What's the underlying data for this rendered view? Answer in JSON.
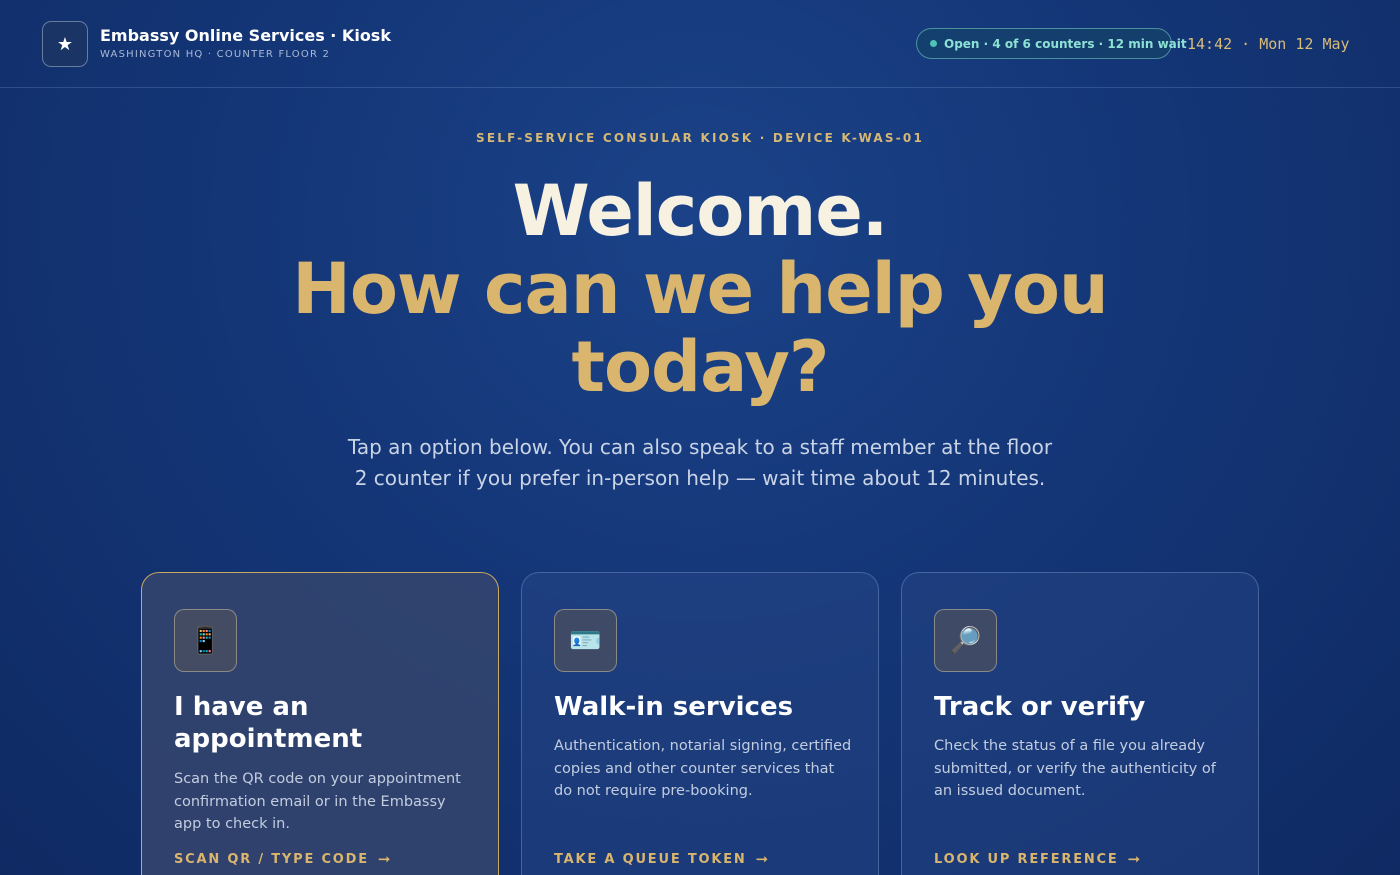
{
  "header": {
    "logo_icon": "star-icon",
    "logo_glyph": "★",
    "title": "Embassy Online Services · Kiosk",
    "subtitle": "WASHINGTON HQ · COUNTER FLOOR 2",
    "status": "Open · 4 of 6 counters · 12 min wait",
    "clock": "14:42 · Mon 12 May"
  },
  "hero": {
    "eyebrow": "SELF-SERVICE CONSULAR KIOSK · DEVICE K-WAS-01",
    "title_line1": "Welcome.",
    "title_line2": "How can we help you today?",
    "description": "Tap an option below. You can also speak to a staff member at the floor 2 counter if you prefer in-person help — wait time about 12 minutes."
  },
  "cards": [
    {
      "icon": "mobile-phone-icon",
      "glyph": "📱",
      "title": "I have an appointment",
      "description": "Scan the QR code on your appointment confirmation email or in the Embassy app to check in.",
      "action": "SCAN QR / TYPE CODE"
    },
    {
      "icon": "id-card-icon",
      "glyph": "🪪",
      "title": "Walk-in services",
      "description": "Authentication, notarial signing, certified copies and other counter services that do not require pre-booking.",
      "action": "TAKE A QUEUE TOKEN"
    },
    {
      "icon": "magnifier-icon",
      "glyph": "🔎",
      "title": "Track or verify",
      "description": "Check the status of a file you already submitted, or verify the authenticity of an issued document.",
      "action": "LOOK UP REFERENCE"
    }
  ],
  "colors": {
    "accent_gold": "#d9b56e",
    "status_teal": "#4fc3b3",
    "background_navy": "#143677"
  }
}
